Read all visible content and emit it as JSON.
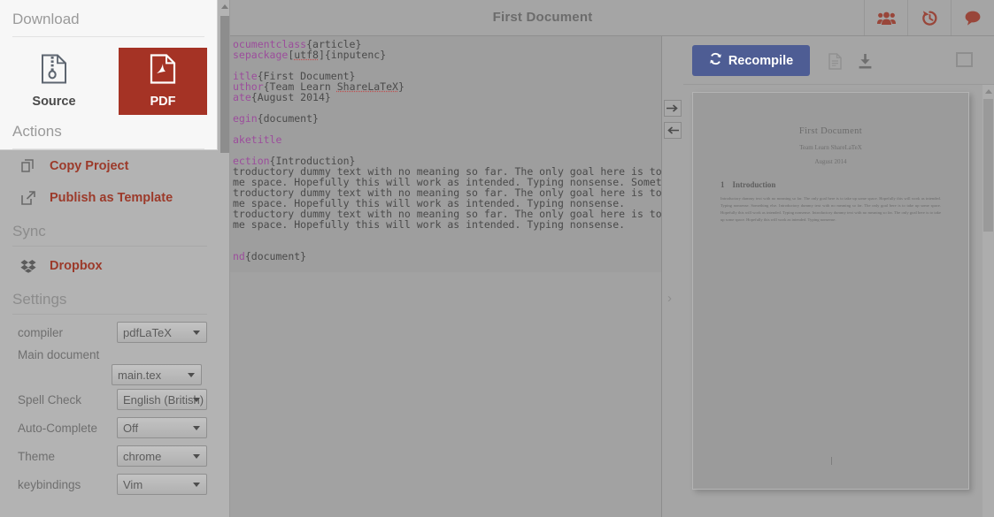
{
  "header": {
    "title": "First Document",
    "icons": [
      {
        "name": "collaborators-icon",
        "label": "Collaborators"
      },
      {
        "name": "history-icon",
        "label": "History"
      },
      {
        "name": "chat-icon",
        "label": "Chat"
      }
    ]
  },
  "editor": {
    "lines": [
      {
        "cmd": "ocumentclass",
        "rest": "{article}"
      },
      {
        "cmd": "sepackage",
        "rest": "[utf8]{inputenc}",
        "spell": "utf8"
      },
      {
        "cmd": "",
        "rest": ""
      },
      {
        "cmd": "itle",
        "rest": "{First Document}"
      },
      {
        "cmd": "uthor",
        "rest": "{Team Learn ShareLaTeX}",
        "spell": "ShareLaTeX"
      },
      {
        "cmd": "ate",
        "rest": "{August 2014}"
      },
      {
        "cmd": "",
        "rest": ""
      },
      {
        "cmd": "egin",
        "rest": "{document}"
      },
      {
        "cmd": "",
        "rest": ""
      },
      {
        "cmd": "aketitle",
        "rest": ""
      },
      {
        "cmd": "",
        "rest": ""
      },
      {
        "cmd": "ection",
        "rest": "{Introduction}"
      }
    ],
    "body": [
      "troductory dummy text with no meaning so far. The only goal here is to take up",
      "me space. Hopefully this will work as intended. Typing nonsense. Something else.",
      "troductory dummy text with no meaning so far. The only goal here is to take up",
      "me space. Hopefully this will work as intended. Typing nonsense.",
      "troductory dummy text with no meaning so far. The only goal here is to take up",
      "me space. Hopefully this will work as intended. Typing nonsense."
    ],
    "end_cmd": "nd",
    "end_rest": "{document}"
  },
  "splitter": {
    "forward_label": "→",
    "back_label": "←",
    "expand_label": "›"
  },
  "pdf": {
    "recompile_label": "Recompile",
    "recompile_color": "#4e5d94",
    "doc_icon": "document-icon",
    "download_icon": "download-icon",
    "fullscreen_icon": "expand-icon",
    "preview": {
      "title": "First Document",
      "author": "Team Learn ShareLaTeX",
      "date": "August 2014",
      "section_number": "1",
      "section_title": "Introduction",
      "paragraph": "Introductory dummy text with no meaning so far. The only goal here is to take up some space. Hopefully this will work as intended. Typing nonsense. Something else. Introductory dummy text with no meaning so far. The only goal here is to take up some space. Hopefully this will work as intended. Typing nonsense. Introductory dummy text with no meaning so far. The only goal here is to take up some space. Hopefully this will work as intended. Typing nonsense."
    }
  },
  "download_menu": {
    "heading": "Download",
    "source_label": "Source",
    "pdf_label": "PDF",
    "pdf_color": "#a53325",
    "actions_heading": "Actions"
  },
  "sidebar": {
    "actions": [
      {
        "label": "Copy Project",
        "icon": "copy-icon"
      },
      {
        "label": "Publish as Template",
        "icon": "external-link-icon"
      }
    ],
    "sync_heading": "Sync",
    "sync_items": [
      {
        "label": "Dropbox",
        "icon": "dropbox-icon"
      }
    ],
    "settings_heading": "Settings",
    "settings": [
      {
        "label": "compiler",
        "value": "pdfLaTeX",
        "stacked": false
      },
      {
        "label": "Main document",
        "value": "main.tex",
        "stacked": true
      },
      {
        "label": "Spell Check",
        "value": "English (British)",
        "stacked": false
      },
      {
        "label": "Auto-Complete",
        "value": "Off",
        "stacked": false
      },
      {
        "label": "Theme",
        "value": "chrome",
        "stacked": false
      },
      {
        "label": "keybindings",
        "value": "Vim",
        "stacked": false
      }
    ],
    "accent_color": "#9c3a2a"
  }
}
